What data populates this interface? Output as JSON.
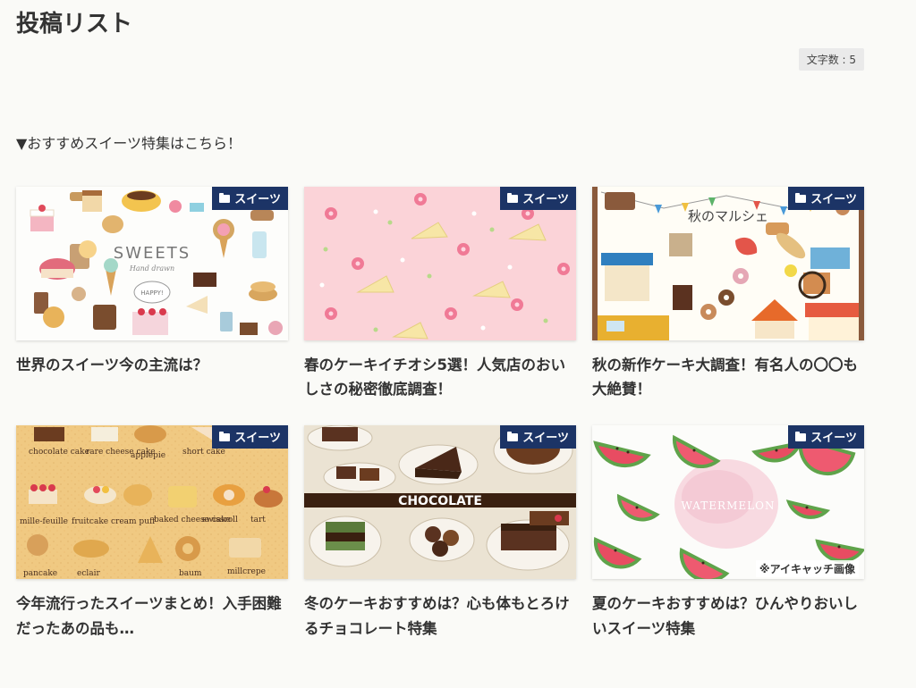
{
  "page": {
    "title": "投稿リスト",
    "char_count": "文字数 : 5",
    "intro": "▼おすすめスイーツ特集はこちら！"
  },
  "posts": [
    {
      "title": "世界のスイーツ今の主流は？",
      "category": "スイーツ",
      "thumb_text": "SWEETS",
      "thumb_subtext": "Hand drawn",
      "thumb_badge": "HAPPY!",
      "note": ""
    },
    {
      "title": "春のケーキイチオシ5選！人気店のおいしさの秘密徹底調査！",
      "category": "スイーツ",
      "thumb_text": "",
      "thumb_subtext": "",
      "thumb_badge": "",
      "note": ""
    },
    {
      "title": "秋の新作ケーキ大調査！有名人の〇〇も大絶賛！",
      "category": "スイーツ",
      "thumb_text": "秋のマルシェ",
      "thumb_subtext": "",
      "thumb_badge": "",
      "note": ""
    },
    {
      "title": "今年流行ったスイーツまとめ！入手困難だったあの品も…",
      "category": "スイーツ",
      "thumb_text": "",
      "thumb_subtext": "",
      "thumb_badge": "",
      "note": "",
      "thumb_words": [
        "chocolate cake",
        "rare cheese cake",
        "applepie",
        "short cake",
        "mille-feuille",
        "fruitcake",
        "cream puff",
        "baked cheese cake",
        "swissroll",
        "tart",
        "pancake",
        "eclair",
        "baum",
        "millcrepe"
      ]
    },
    {
      "title": "冬のケーキおすすめは？心も体もとろけるチョコレート特集",
      "category": "スイーツ",
      "thumb_text": "CHOCOLATE",
      "thumb_subtext": "",
      "thumb_badge": "",
      "note": ""
    },
    {
      "title": "夏のケーキおすすめは？ひんやりおいしいスイーツ特集",
      "category": "スイーツ",
      "thumb_text": "WATERMELON",
      "thumb_subtext": "",
      "thumb_badge": "",
      "note": "※アイキャッチ画像"
    }
  ]
}
